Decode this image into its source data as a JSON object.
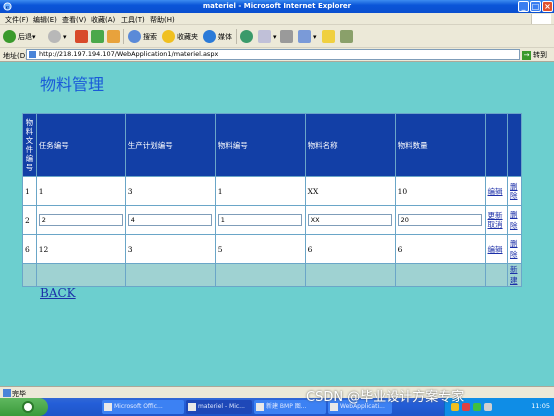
{
  "window": {
    "title": "materiel - Microsoft Internet Explorer"
  },
  "menu": [
    "文件(F)",
    "编辑(E)",
    "查看(V)",
    "收藏(A)",
    "工具(T)",
    "帮助(H)"
  ],
  "toolbar": {
    "back": "后退",
    "search": "搜索",
    "favorites": "收藏夹",
    "media": "媒体"
  },
  "address": {
    "label": "地址(D)",
    "url": "http://218.197.194.107/WebApplication1/materiel.aspx",
    "go": "转到"
  },
  "page": {
    "title": "物料管理",
    "back_link": "BACK"
  },
  "grid": {
    "headers": {
      "id_chars": [
        "物",
        "料",
        "文",
        "件",
        "编",
        "号"
      ],
      "task_no": "任务编号",
      "plan_no": "生产计划编号",
      "material_no": "物料编号",
      "material_name": "物料名称",
      "quantity": "物料数量"
    },
    "rows": [
      {
        "id": "1",
        "task_no": "1",
        "plan_no": "3",
        "material_no": "1",
        "material_name": "XX",
        "quantity": "10",
        "edit": "编辑",
        "delete": "删除"
      },
      {
        "id": "2",
        "task_no": "2",
        "plan_no": "4",
        "material_no": "1",
        "material_name": "XX",
        "quantity": "20",
        "update": "更新",
        "cancel": "取消",
        "delete": "删除"
      },
      {
        "id": "6",
        "task_no": "12",
        "plan_no": "3",
        "material_no": "5",
        "material_name": "6",
        "quantity": "6",
        "edit": "编辑",
        "delete": "删除"
      }
    ],
    "footer_new": "新建"
  },
  "status": {
    "text": "完毕"
  },
  "taskbar": {
    "tasks": [
      "Microsoft Offic...",
      "materiel - Mic...",
      "新建 BMP 图...",
      "WebApplicati..."
    ],
    "clock": "11:05"
  },
  "watermark": "CSDN @毕业设计方案专家",
  "colors": {
    "background": "#6ccfcf",
    "header": "#123fa6",
    "title": "#1a5ad8",
    "link": "#1c2fa8"
  }
}
